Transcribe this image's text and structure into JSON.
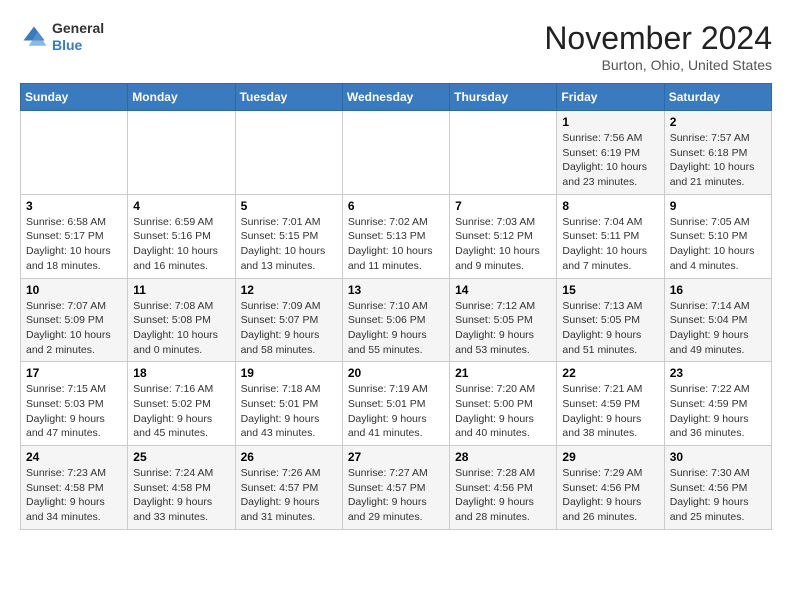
{
  "header": {
    "logo_general": "General",
    "logo_blue": "Blue",
    "month_title": "November 2024",
    "location": "Burton, Ohio, United States"
  },
  "days_of_week": [
    "Sunday",
    "Monday",
    "Tuesday",
    "Wednesday",
    "Thursday",
    "Friday",
    "Saturday"
  ],
  "weeks": [
    [
      {
        "day": "",
        "info": ""
      },
      {
        "day": "",
        "info": ""
      },
      {
        "day": "",
        "info": ""
      },
      {
        "day": "",
        "info": ""
      },
      {
        "day": "",
        "info": ""
      },
      {
        "day": "1",
        "info": "Sunrise: 7:56 AM\nSunset: 6:19 PM\nDaylight: 10 hours and 23 minutes."
      },
      {
        "day": "2",
        "info": "Sunrise: 7:57 AM\nSunset: 6:18 PM\nDaylight: 10 hours and 21 minutes."
      }
    ],
    [
      {
        "day": "3",
        "info": "Sunrise: 6:58 AM\nSunset: 5:17 PM\nDaylight: 10 hours and 18 minutes."
      },
      {
        "day": "4",
        "info": "Sunrise: 6:59 AM\nSunset: 5:16 PM\nDaylight: 10 hours and 16 minutes."
      },
      {
        "day": "5",
        "info": "Sunrise: 7:01 AM\nSunset: 5:15 PM\nDaylight: 10 hours and 13 minutes."
      },
      {
        "day": "6",
        "info": "Sunrise: 7:02 AM\nSunset: 5:13 PM\nDaylight: 10 hours and 11 minutes."
      },
      {
        "day": "7",
        "info": "Sunrise: 7:03 AM\nSunset: 5:12 PM\nDaylight: 10 hours and 9 minutes."
      },
      {
        "day": "8",
        "info": "Sunrise: 7:04 AM\nSunset: 5:11 PM\nDaylight: 10 hours and 7 minutes."
      },
      {
        "day": "9",
        "info": "Sunrise: 7:05 AM\nSunset: 5:10 PM\nDaylight: 10 hours and 4 minutes."
      }
    ],
    [
      {
        "day": "10",
        "info": "Sunrise: 7:07 AM\nSunset: 5:09 PM\nDaylight: 10 hours and 2 minutes."
      },
      {
        "day": "11",
        "info": "Sunrise: 7:08 AM\nSunset: 5:08 PM\nDaylight: 10 hours and 0 minutes."
      },
      {
        "day": "12",
        "info": "Sunrise: 7:09 AM\nSunset: 5:07 PM\nDaylight: 9 hours and 58 minutes."
      },
      {
        "day": "13",
        "info": "Sunrise: 7:10 AM\nSunset: 5:06 PM\nDaylight: 9 hours and 55 minutes."
      },
      {
        "day": "14",
        "info": "Sunrise: 7:12 AM\nSunset: 5:05 PM\nDaylight: 9 hours and 53 minutes."
      },
      {
        "day": "15",
        "info": "Sunrise: 7:13 AM\nSunset: 5:05 PM\nDaylight: 9 hours and 51 minutes."
      },
      {
        "day": "16",
        "info": "Sunrise: 7:14 AM\nSunset: 5:04 PM\nDaylight: 9 hours and 49 minutes."
      }
    ],
    [
      {
        "day": "17",
        "info": "Sunrise: 7:15 AM\nSunset: 5:03 PM\nDaylight: 9 hours and 47 minutes."
      },
      {
        "day": "18",
        "info": "Sunrise: 7:16 AM\nSunset: 5:02 PM\nDaylight: 9 hours and 45 minutes."
      },
      {
        "day": "19",
        "info": "Sunrise: 7:18 AM\nSunset: 5:01 PM\nDaylight: 9 hours and 43 minutes."
      },
      {
        "day": "20",
        "info": "Sunrise: 7:19 AM\nSunset: 5:01 PM\nDaylight: 9 hours and 41 minutes."
      },
      {
        "day": "21",
        "info": "Sunrise: 7:20 AM\nSunset: 5:00 PM\nDaylight: 9 hours and 40 minutes."
      },
      {
        "day": "22",
        "info": "Sunrise: 7:21 AM\nSunset: 4:59 PM\nDaylight: 9 hours and 38 minutes."
      },
      {
        "day": "23",
        "info": "Sunrise: 7:22 AM\nSunset: 4:59 PM\nDaylight: 9 hours and 36 minutes."
      }
    ],
    [
      {
        "day": "24",
        "info": "Sunrise: 7:23 AM\nSunset: 4:58 PM\nDaylight: 9 hours and 34 minutes."
      },
      {
        "day": "25",
        "info": "Sunrise: 7:24 AM\nSunset: 4:58 PM\nDaylight: 9 hours and 33 minutes."
      },
      {
        "day": "26",
        "info": "Sunrise: 7:26 AM\nSunset: 4:57 PM\nDaylight: 9 hours and 31 minutes."
      },
      {
        "day": "27",
        "info": "Sunrise: 7:27 AM\nSunset: 4:57 PM\nDaylight: 9 hours and 29 minutes."
      },
      {
        "day": "28",
        "info": "Sunrise: 7:28 AM\nSunset: 4:56 PM\nDaylight: 9 hours and 28 minutes."
      },
      {
        "day": "29",
        "info": "Sunrise: 7:29 AM\nSunset: 4:56 PM\nDaylight: 9 hours and 26 minutes."
      },
      {
        "day": "30",
        "info": "Sunrise: 7:30 AM\nSunset: 4:56 PM\nDaylight: 9 hours and 25 minutes."
      }
    ]
  ]
}
